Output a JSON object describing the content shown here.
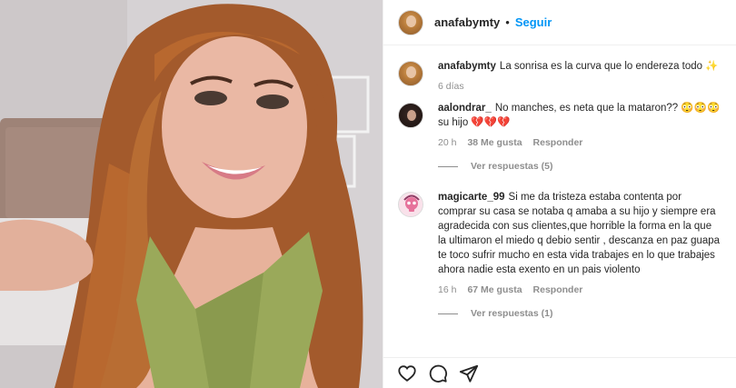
{
  "header": {
    "username": "anafabymty",
    "separator": "•",
    "follow_label": "Seguir"
  },
  "caption": {
    "username": "anafabymty",
    "text": "La sonrisa es la curva que lo endereza todo ✨",
    "time": "6 días"
  },
  "comments": [
    {
      "username": "aalondrar_",
      "text": "No manches, es neta que la mataron?? 😳😳😳 su hijo 💔💔💔",
      "time": "20 h",
      "likes": "38 Me gusta",
      "reply_label": "Responder",
      "view_replies": "Ver respuestas (5)"
    },
    {
      "username": "magicarte_99",
      "text": "Si me da tristeza estaba contenta por comprar su casa se notaba q amaba a su hijo y siempre era agradecida con sus clientes,que horrible la forma en la que la ultimaron el miedo q debio sentir , descanza en paz guapa te toco sufrir mucho en esta vida trabajes en lo que trabajes ahora nadie esta exento en un pais violento",
      "time": "16 h",
      "likes": "67 Me gusta",
      "reply_label": "Responder",
      "view_replies": "Ver respuestas (1)"
    }
  ],
  "actions": {
    "icons": [
      "heart-icon",
      "comment-icon",
      "share-icon"
    ]
  },
  "colors": {
    "accent": "#0095f6",
    "text": "#262626",
    "muted": "#8e8e8e",
    "border": "#efefef"
  }
}
